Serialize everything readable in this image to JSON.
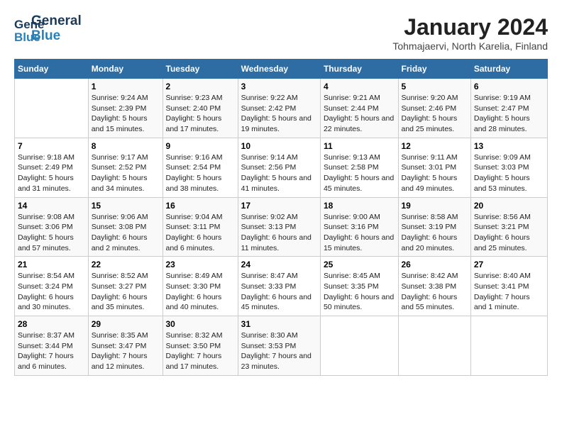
{
  "header": {
    "logo_general": "General",
    "logo_blue": "Blue",
    "title": "January 2024",
    "subtitle": "Tohmajaervi, North Karelia, Finland"
  },
  "days_of_week": [
    "Sunday",
    "Monday",
    "Tuesday",
    "Wednesday",
    "Thursday",
    "Friday",
    "Saturday"
  ],
  "weeks": [
    [
      {
        "day": "",
        "sunrise": "",
        "sunset": "",
        "daylight": ""
      },
      {
        "day": "1",
        "sunrise": "Sunrise: 9:24 AM",
        "sunset": "Sunset: 2:39 PM",
        "daylight": "Daylight: 5 hours and 15 minutes."
      },
      {
        "day": "2",
        "sunrise": "Sunrise: 9:23 AM",
        "sunset": "Sunset: 2:40 PM",
        "daylight": "Daylight: 5 hours and 17 minutes."
      },
      {
        "day": "3",
        "sunrise": "Sunrise: 9:22 AM",
        "sunset": "Sunset: 2:42 PM",
        "daylight": "Daylight: 5 hours and 19 minutes."
      },
      {
        "day": "4",
        "sunrise": "Sunrise: 9:21 AM",
        "sunset": "Sunset: 2:44 PM",
        "daylight": "Daylight: 5 hours and 22 minutes."
      },
      {
        "day": "5",
        "sunrise": "Sunrise: 9:20 AM",
        "sunset": "Sunset: 2:46 PM",
        "daylight": "Daylight: 5 hours and 25 minutes."
      },
      {
        "day": "6",
        "sunrise": "Sunrise: 9:19 AM",
        "sunset": "Sunset: 2:47 PM",
        "daylight": "Daylight: 5 hours and 28 minutes."
      }
    ],
    [
      {
        "day": "7",
        "sunrise": "Sunrise: 9:18 AM",
        "sunset": "Sunset: 2:49 PM",
        "daylight": "Daylight: 5 hours and 31 minutes."
      },
      {
        "day": "8",
        "sunrise": "Sunrise: 9:17 AM",
        "sunset": "Sunset: 2:52 PM",
        "daylight": "Daylight: 5 hours and 34 minutes."
      },
      {
        "day": "9",
        "sunrise": "Sunrise: 9:16 AM",
        "sunset": "Sunset: 2:54 PM",
        "daylight": "Daylight: 5 hours and 38 minutes."
      },
      {
        "day": "10",
        "sunrise": "Sunrise: 9:14 AM",
        "sunset": "Sunset: 2:56 PM",
        "daylight": "Daylight: 5 hours and 41 minutes."
      },
      {
        "day": "11",
        "sunrise": "Sunrise: 9:13 AM",
        "sunset": "Sunset: 2:58 PM",
        "daylight": "Daylight: 5 hours and 45 minutes."
      },
      {
        "day": "12",
        "sunrise": "Sunrise: 9:11 AM",
        "sunset": "Sunset: 3:01 PM",
        "daylight": "Daylight: 5 hours and 49 minutes."
      },
      {
        "day": "13",
        "sunrise": "Sunrise: 9:09 AM",
        "sunset": "Sunset: 3:03 PM",
        "daylight": "Daylight: 5 hours and 53 minutes."
      }
    ],
    [
      {
        "day": "14",
        "sunrise": "Sunrise: 9:08 AM",
        "sunset": "Sunset: 3:06 PM",
        "daylight": "Daylight: 5 hours and 57 minutes."
      },
      {
        "day": "15",
        "sunrise": "Sunrise: 9:06 AM",
        "sunset": "Sunset: 3:08 PM",
        "daylight": "Daylight: 6 hours and 2 minutes."
      },
      {
        "day": "16",
        "sunrise": "Sunrise: 9:04 AM",
        "sunset": "Sunset: 3:11 PM",
        "daylight": "Daylight: 6 hours and 6 minutes."
      },
      {
        "day": "17",
        "sunrise": "Sunrise: 9:02 AM",
        "sunset": "Sunset: 3:13 PM",
        "daylight": "Daylight: 6 hours and 11 minutes."
      },
      {
        "day": "18",
        "sunrise": "Sunrise: 9:00 AM",
        "sunset": "Sunset: 3:16 PM",
        "daylight": "Daylight: 6 hours and 15 minutes."
      },
      {
        "day": "19",
        "sunrise": "Sunrise: 8:58 AM",
        "sunset": "Sunset: 3:19 PM",
        "daylight": "Daylight: 6 hours and 20 minutes."
      },
      {
        "day": "20",
        "sunrise": "Sunrise: 8:56 AM",
        "sunset": "Sunset: 3:21 PM",
        "daylight": "Daylight: 6 hours and 25 minutes."
      }
    ],
    [
      {
        "day": "21",
        "sunrise": "Sunrise: 8:54 AM",
        "sunset": "Sunset: 3:24 PM",
        "daylight": "Daylight: 6 hours and 30 minutes."
      },
      {
        "day": "22",
        "sunrise": "Sunrise: 8:52 AM",
        "sunset": "Sunset: 3:27 PM",
        "daylight": "Daylight: 6 hours and 35 minutes."
      },
      {
        "day": "23",
        "sunrise": "Sunrise: 8:49 AM",
        "sunset": "Sunset: 3:30 PM",
        "daylight": "Daylight: 6 hours and 40 minutes."
      },
      {
        "day": "24",
        "sunrise": "Sunrise: 8:47 AM",
        "sunset": "Sunset: 3:33 PM",
        "daylight": "Daylight: 6 hours and 45 minutes."
      },
      {
        "day": "25",
        "sunrise": "Sunrise: 8:45 AM",
        "sunset": "Sunset: 3:35 PM",
        "daylight": "Daylight: 6 hours and 50 minutes."
      },
      {
        "day": "26",
        "sunrise": "Sunrise: 8:42 AM",
        "sunset": "Sunset: 3:38 PM",
        "daylight": "Daylight: 6 hours and 55 minutes."
      },
      {
        "day": "27",
        "sunrise": "Sunrise: 8:40 AM",
        "sunset": "Sunset: 3:41 PM",
        "daylight": "Daylight: 7 hours and 1 minute."
      }
    ],
    [
      {
        "day": "28",
        "sunrise": "Sunrise: 8:37 AM",
        "sunset": "Sunset: 3:44 PM",
        "daylight": "Daylight: 7 hours and 6 minutes."
      },
      {
        "day": "29",
        "sunrise": "Sunrise: 8:35 AM",
        "sunset": "Sunset: 3:47 PM",
        "daylight": "Daylight: 7 hours and 12 minutes."
      },
      {
        "day": "30",
        "sunrise": "Sunrise: 8:32 AM",
        "sunset": "Sunset: 3:50 PM",
        "daylight": "Daylight: 7 hours and 17 minutes."
      },
      {
        "day": "31",
        "sunrise": "Sunrise: 8:30 AM",
        "sunset": "Sunset: 3:53 PM",
        "daylight": "Daylight: 7 hours and 23 minutes."
      },
      {
        "day": "",
        "sunrise": "",
        "sunset": "",
        "daylight": ""
      },
      {
        "day": "",
        "sunrise": "",
        "sunset": "",
        "daylight": ""
      },
      {
        "day": "",
        "sunrise": "",
        "sunset": "",
        "daylight": ""
      }
    ]
  ]
}
